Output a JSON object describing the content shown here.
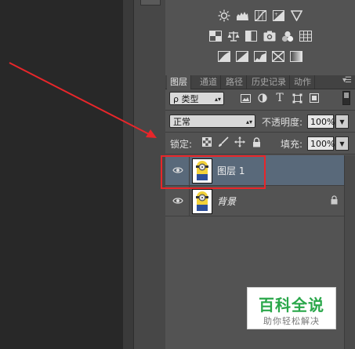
{
  "icons": {
    "adjust_row1": [
      "brightness-icon",
      "levels-icon",
      "curves-icon",
      "exposure-icon",
      "gradient-triangle-icon"
    ],
    "adjust_row2": [
      "vibrance-icon",
      "balance-icon",
      "bw-icon",
      "photo-filter-icon",
      "channel-mixer-icon",
      "color-lookup-icon"
    ],
    "adjust_row3": [
      "invert-icon",
      "posterize-icon",
      "threshold-icon",
      "selective-color-icon",
      "gradient-map-icon"
    ]
  },
  "tabs": [
    {
      "label": "图层"
    },
    {
      "label": "通道"
    },
    {
      "label": "路径"
    },
    {
      "label": "历史记录"
    },
    {
      "label": "动作"
    }
  ],
  "filter": {
    "kind_label": "ρ 类型",
    "kind_glyph": "ρ",
    "kind_text": "类型",
    "type_glyph": "T"
  },
  "blend": {
    "mode": "正常",
    "opacity_label": "不透明度:",
    "opacity_value": "100%"
  },
  "lock": {
    "label": "锁定:",
    "fill_label": "填充:",
    "fill_value": "100%"
  },
  "layers": [
    {
      "name": "图层 1",
      "selected": true,
      "locked": false,
      "italic": false
    },
    {
      "name": "背景",
      "selected": false,
      "locked": true,
      "italic": true
    }
  ],
  "watermark": {
    "title": "百科全说",
    "subtitle": "助你轻松解决"
  },
  "colors": {
    "panel_bg": "#535353",
    "selected_layer": "#59697a",
    "annotation_red": "#e8262a",
    "watermark_green": "#2aa74a"
  }
}
